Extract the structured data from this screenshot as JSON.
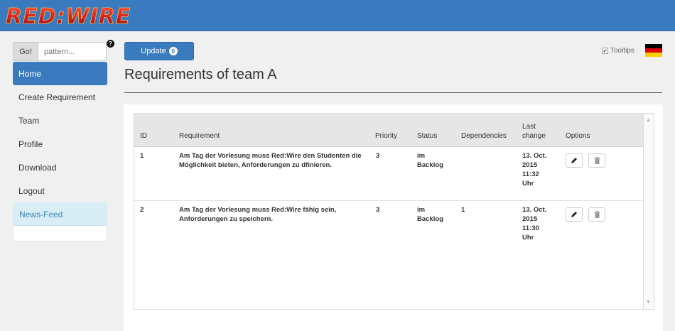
{
  "app": {
    "logo_text": "RED:WIRE"
  },
  "sidebar": {
    "go_label": "Go!",
    "search_placeholder": "pattern...",
    "help_symbol": "?",
    "items": [
      {
        "label": "Home",
        "active": true
      },
      {
        "label": "Create Requirement",
        "active": false
      },
      {
        "label": "Team",
        "active": false
      },
      {
        "label": "Profile",
        "active": false
      },
      {
        "label": "Download",
        "active": false
      },
      {
        "label": "Logout",
        "active": false
      }
    ],
    "newsfeed_label": "News-Feed"
  },
  "toolbar": {
    "update_label": "Update",
    "update_count": "0",
    "tooltips_label": "Tooltips",
    "tooltips_checked": true,
    "language_flag": "german-flag-icon"
  },
  "main": {
    "title": "Requirements of team A"
  },
  "table": {
    "columns": [
      "ID",
      "Requirement",
      "Priority",
      "Status",
      "Dependencies",
      "Last change",
      "Options"
    ],
    "rows": [
      {
        "id": "1",
        "requirement": "Am Tag der Vorlesung muss Red:Wire den Studenten die Möglichkeit bieten, Anforderungen zu dfinieren.",
        "priority": "3",
        "status": "im Backlog",
        "dependencies": "",
        "last_change": "13. Oct. 2015 11:32 Uhr"
      },
      {
        "id": "2",
        "requirement": "Am Tag der Vorlesung muss Red:Wire fähig sein, Anforderungen zu speichern.",
        "priority": "3",
        "status": "im Backlog",
        "dependencies": "1",
        "last_change": "13. Oct. 2015 11:30 Uhr"
      }
    ]
  },
  "colors": {
    "brand_blue": "#3a7bbf",
    "logo_red": "#d62020",
    "newsfeed_bg": "#d9edf7"
  }
}
